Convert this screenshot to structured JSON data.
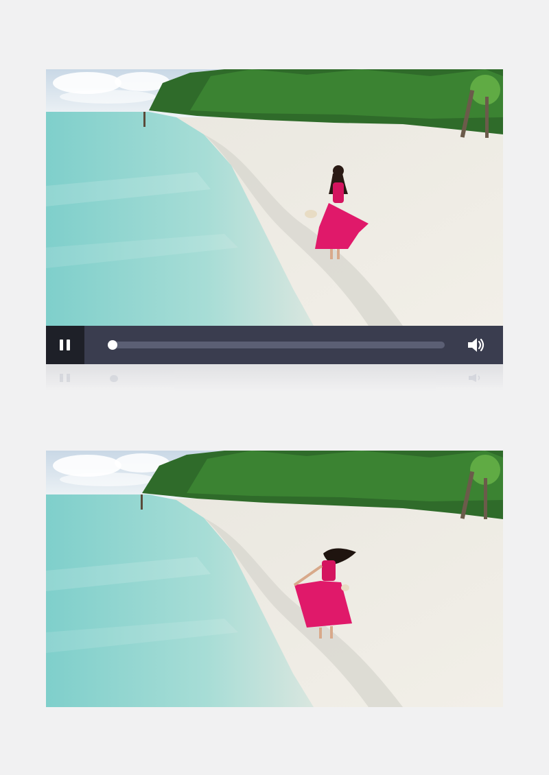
{
  "player": {
    "state": "playing",
    "progress": 0.0,
    "volume_state": "on",
    "colors": {
      "controls_bg": "#3a3d4f",
      "play_button_bg": "#1e2028",
      "track": "#5b5f74",
      "knob": "#ffffff"
    },
    "icons": {
      "play_toggle": "pause-icon",
      "volume": "volume-icon"
    }
  },
  "frames": [
    {
      "scene": "beach-woman-pink-dress-walking"
    },
    {
      "scene": "beach-woman-pink-dress-twirling"
    }
  ],
  "colors": {
    "page_bg": "#f1f1f2",
    "sea": "#8fd2cf",
    "sand": "#ece9e2",
    "foliage": "#2f6b2a",
    "dress": "#e0196a"
  }
}
